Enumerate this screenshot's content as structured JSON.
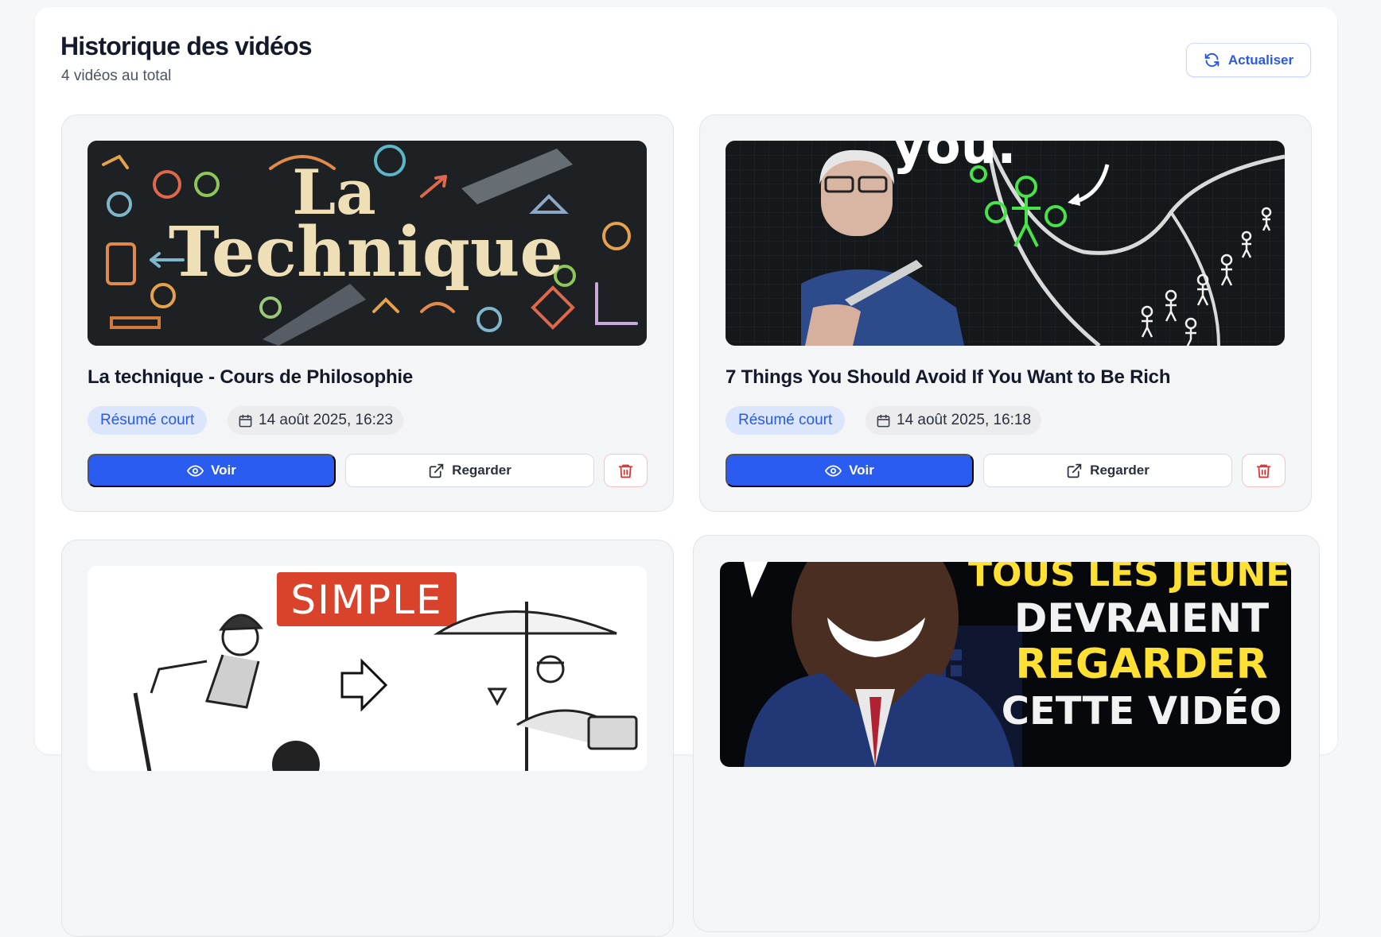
{
  "header": {
    "title": "Historique des vidéos",
    "subtitle": "4 vidéos au total",
    "refresh_label": "Actualiser"
  },
  "videos": [
    {
      "title": "La technique - Cours de Philosophie",
      "badge": "Résumé court",
      "date": "14 août 2025, 16:23",
      "view_label": "Voir",
      "watch_label": "Regarder",
      "thumb_lines": [
        "La",
        "Technique"
      ]
    },
    {
      "title": "7 Things You Should Avoid If You Want to Be Rich",
      "badge": "Résumé court",
      "date": "14 août 2025, 16:18",
      "view_label": "Voir",
      "watch_label": "Regarder",
      "thumb_lines": [
        "you."
      ]
    },
    {
      "thumb_lines": [
        "SIMPLE"
      ]
    },
    {
      "thumb_lines": [
        "TOUS LES JEUNES",
        "DEVRAIENT",
        "REGARDER",
        "CETTE VIDÉO"
      ]
    }
  ],
  "colors": {
    "accent": "#2b5cf0",
    "badge_bg": "#dbe6fc",
    "delete": "#e03131"
  }
}
